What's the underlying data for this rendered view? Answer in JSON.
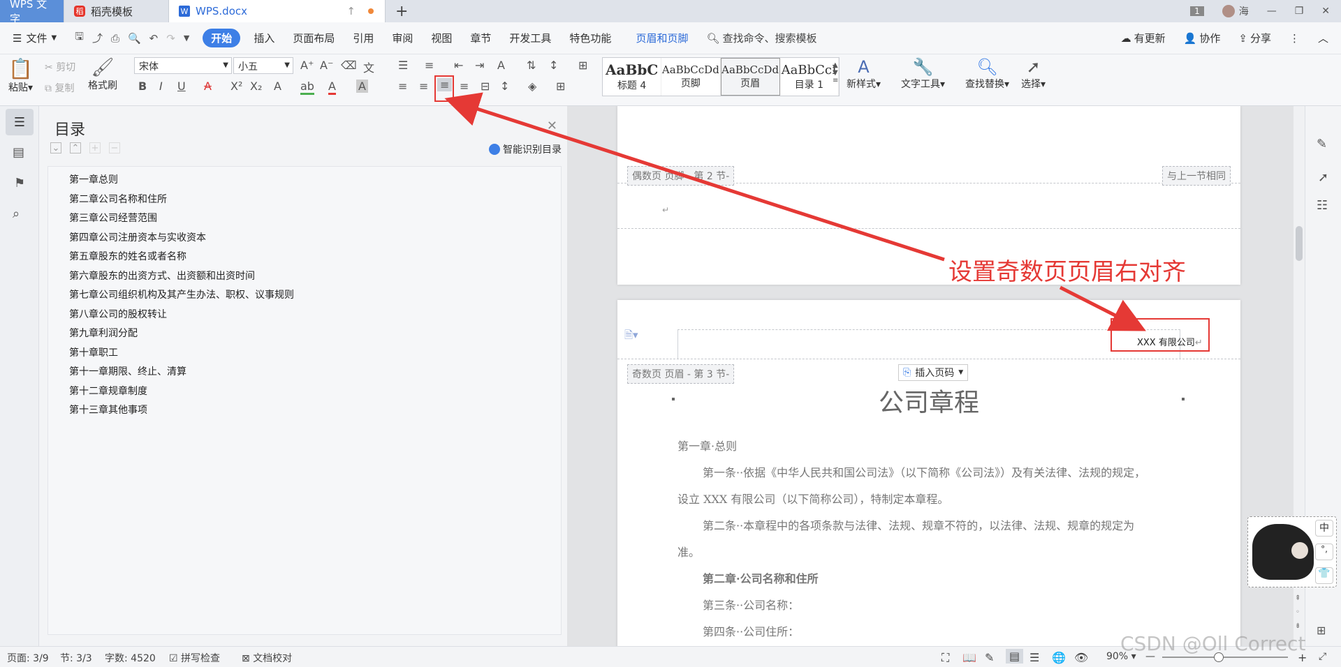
{
  "tabs": {
    "app": "WPS 文字",
    "templates": "稻壳模板",
    "doc": "WPS.docx",
    "new_tab": "+"
  },
  "window": {
    "badge": "1",
    "user": "海"
  },
  "menu": {
    "file": "文件",
    "items": [
      "开始",
      "插入",
      "页面布局",
      "引用",
      "审阅",
      "视图",
      "章节",
      "开发工具",
      "特色功能",
      "页眉和页脚"
    ],
    "search": "查找命令、搜索模板",
    "update": "有更新",
    "collab": "协作",
    "share": "分享"
  },
  "ribbon": {
    "paste": "粘贴",
    "cut": "剪切",
    "copy": "复制",
    "format_painter": "格式刷",
    "font_name": "宋体",
    "font_size": "小五",
    "styles": [
      {
        "preview": "AaBbC",
        "name": "标题 4"
      },
      {
        "preview": "AaBbCcDd",
        "name": "页脚"
      },
      {
        "preview": "AaBbCcDd",
        "name": "页眉"
      },
      {
        "preview": "AaBbCcI",
        "name": "目录 1"
      }
    ],
    "new_style": "新样式",
    "text_tools": "文字工具",
    "find_replace": "查找替换",
    "select": "选择"
  },
  "nav": {
    "title": "目录",
    "smart": "智能识别目录",
    "items": [
      "第一章总则",
      "第二章公司名称和住所",
      "第三章公司经营范围",
      "第四章公司注册资本与实收资本",
      "第五章股东的姓名或者名称",
      "第六章股东的出资方式、出资额和出资时间",
      "第七章公司组织机构及其产生办法、职权、议事规则",
      "第八章公司的股权转让",
      "第九章利润分配",
      "第十章职工",
      "第十一章期限、终止、清算",
      "第十二章规章制度",
      "第十三章其他事项"
    ]
  },
  "doc": {
    "even_footer_tag": "偶数页 页脚 - 第 2 节-",
    "same_as_prev": "与上一节相同",
    "odd_header_tag": "奇数页 页眉 - 第 3 节-",
    "header_text": "XXX 有限公司",
    "insert_page_num": "插入页码",
    "title": "公司章程",
    "ch1": "第一章·总则",
    "art1_a": "第一条··依据《中华人民共和国公司法》（以下简称《公司法》）及有关法律、法规的规定，",
    "art1_b": "设立 XXX 有限公司（以下简称公司），特制定本章程。",
    "art2_a": "第二条··本章程中的各项条款与法律、法规、规章不符的，以法律、法规、规章的规定为",
    "art2_b": "准。",
    "ch2": "第二章·公司名称和住所",
    "art3": "第三条··公司名称：",
    "art4": "第四条··公司住所："
  },
  "annotation": "设置奇数页页眉右对齐",
  "ime": {
    "zh": "中",
    "punct": "°,"
  },
  "status": {
    "page": "页面: 3/9",
    "section": "节: 3/3",
    "words": "字数: 4520",
    "spell": "拼写检查",
    "proof": "文档校对",
    "zoom": "90%"
  },
  "watermark": "CSDN @Oll Correct",
  "colors": {
    "accent": "#3d7fe6",
    "annotation": "#e53935"
  }
}
